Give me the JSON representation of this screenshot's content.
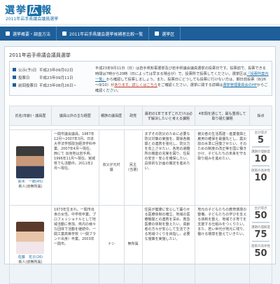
{
  "site": {
    "logo_parts": [
      "選",
      "挙",
      "広",
      "報"
    ],
    "subtitle": "2011年岩手県議会議員選挙"
  },
  "nav": [
    {
      "label": "選挙概要・調査方法"
    },
    {
      "label": "2011年岩手県議会選挙候補者比較一覧"
    },
    {
      "label": "選挙区"
    }
  ],
  "election": {
    "title": "2011年岩手県議会議員選挙",
    "dates": [
      {
        "label": "公示(予)日",
        "value": "平成23年09月02日"
      },
      {
        "label": "投票日",
        "value": "平成23年09月11日"
      },
      {
        "label": "前回投票日",
        "value": "平成23年08月26日~"
      }
    ],
    "desc_1": "平成23年9月11日（日）は岩手県知事選挙及び岩手県議会議員選挙の投票日です。投票前で、投票できる時間は",
    "desc_2": "7時から20時（日によっては早まる場合が）で、投票所で投票してください。選挙区は",
    "desc_link_1": "「投票所案内一覧」",
    "desc_3": "から確認して投票しましょう。また、投票日にどうしても投票に行けない方は、期日前投票（8/26～9/10）が",
    "desc_link_2": "あります。詳しくはこちら",
    "desc_4": "をご確認ください。選挙に関する詳細は",
    "desc_link_3": "選挙管理委員会のHP",
    "desc_5": "からご確認ください。"
  },
  "table": {
    "headers": [
      "氏名(年齢)・議員歴",
      "議員以外の主な経歴",
      "親族の議員歴",
      "政党",
      "最初の1年でまずこれだけは必ず解決したいと考える課題",
      "4年間を通じて、最も重視して取り組む課題",
      "採点"
    ],
    "rows": [
      {
        "name": "鈴木　一郎(45)",
        "status": "新人(旧無所属)",
        "career": "一関市議会議員。1987年12月～2007年3月。日本大学法学部政治経済学科卒業。2007年4月～現在。西にて 出身地は岩手県。1996年11月～現在。宮城県でも活動中。2011年2月～現在。",
        "family": "叔父が元村議",
        "party": "民主",
        "result": "(当選)",
        "issue1": "まずその防災のために必要な防災対策の実施を。関係各機関との連携を強化し、防災力を向上させたい。各地の避難所の機能の充実を図り、住民の安全・安心を確保したい。具体的な計画の策定を進めたい。",
        "issue2": "被災者の生活再建・産業復興と雇用の確保を最優先とし、震災前の水準に回復させたい。そのための制度の改正等を国に働きかけ、子どもたちの未来を守る取り組みを進めたい。",
        "scores": [
          {
            "label": "合計得点",
            "value": "5"
          },
          {
            "label": "課題の理解度",
            "value": "10"
          },
          {
            "label": "施策の具体性",
            "value": "10"
          }
        ]
      },
      {
        "name": "佐藤　花子(26)",
        "status": "新人(旧無所属)",
        "career": "1973年生まれ。一関市出身の女性。中学校卒業。プロフェッショナルとして地域活動に参加、県内の様々な団体で活動を継続中。一関工業高等学校（一関ブランド出身）卒業。2003年一関市。",
        "family": "ナシ",
        "party": "無所属",
        "result": "",
        "issue1": "住民が健康に安心して暮らせる医療体制の確立。地域の医療機関との連携を深め、救急医療の体制を整えたい。高齢者の方々が安心して生活できる地域づくりを目指し、必要な施策を実施したい。",
        "issue2": "地元の子どもたちの教育環境の整備。子どもたちの学びを支える体制を整え、地域で子育てを支援する仕組みをつくりたい。また、若い世代が地元に残り、働ける環境を整えていきたい。",
        "scores": [
          {
            "label": "合計得点",
            "value": "50"
          },
          {
            "label": "課題の理解度",
            "value": "75"
          },
          {
            "label": "施策の具体性",
            "value": "50"
          }
        ]
      }
    ]
  },
  "colors": {
    "brand": "#1e5f9a",
    "link": "#1a6fa8"
  }
}
